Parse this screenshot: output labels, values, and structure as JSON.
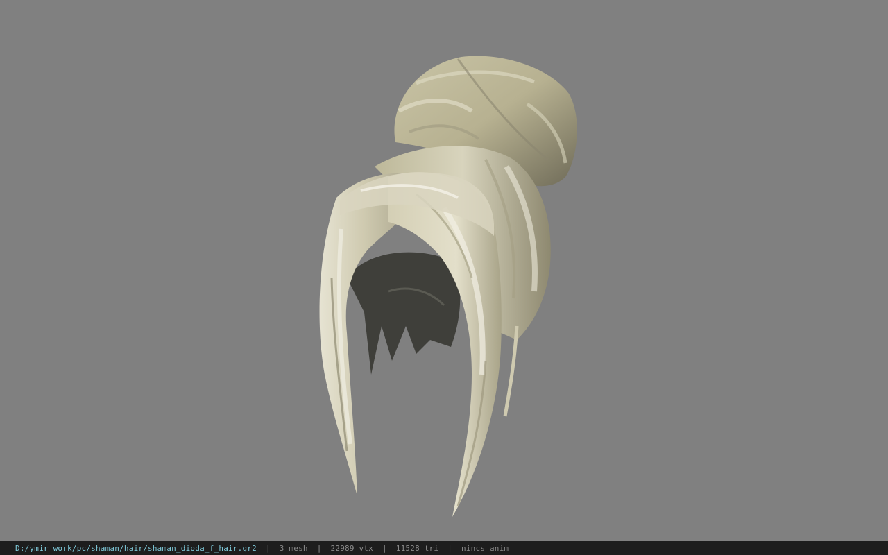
{
  "viewport": {
    "background_color": "#808080",
    "model": {
      "subject": "hair-model",
      "hair_color": "#d6d1b4",
      "hair_shadow_color": "#8f8a72",
      "inner_dark_color": "#3d3d38"
    }
  },
  "statusbar": {
    "file_path": "D:/ymir work/pc/shaman/hair/shaman_dioda_f_hair.gr2",
    "separator": "|",
    "mesh_count": "3 mesh",
    "vertex_count": "22989 vtx",
    "triangle_count": "11528 tri",
    "anim_status": "nincs anim"
  }
}
